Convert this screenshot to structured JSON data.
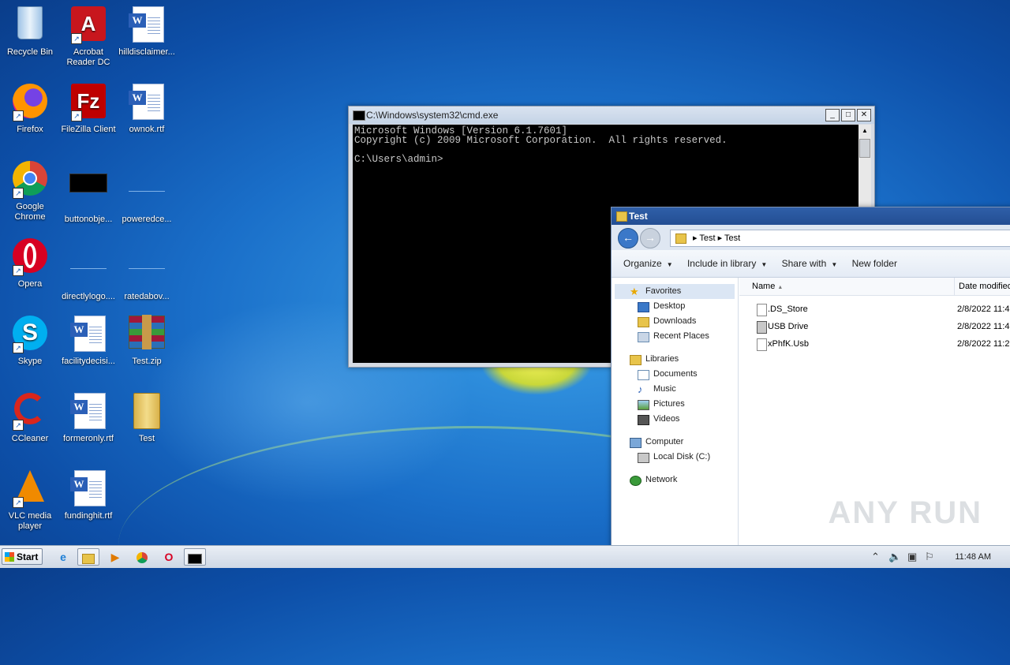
{
  "desktop": {
    "icons": [
      {
        "label": "Recycle Bin"
      },
      {
        "label": "Acrobat Reader DC"
      },
      {
        "label": "hilldisclaimer..."
      },
      {
        "label": "Firefox"
      },
      {
        "label": "FileZilla Client"
      },
      {
        "label": "ownok.rtf"
      },
      {
        "label": "Google Chrome"
      },
      {
        "label": "buttonobje..."
      },
      {
        "label": "poweredce..."
      },
      {
        "label": "Opera"
      },
      {
        "label": "directlylogo...."
      },
      {
        "label": "ratedabov..."
      },
      {
        "label": "Skype"
      },
      {
        "label": "facilitydecisi..."
      },
      {
        "label": "Test.zip"
      },
      {
        "label": "CCleaner"
      },
      {
        "label": "formeronly.rtf"
      },
      {
        "label": "Test"
      },
      {
        "label": "VLC media player"
      },
      {
        "label": "fundinghit.rtf"
      }
    ]
  },
  "cmd": {
    "title": "C:\\Windows\\system32\\cmd.exe",
    "line1": "Microsoft Windows [Version 6.1.7601]",
    "line2": "Copyright (c) 2009 Microsoft Corporation.  All rights reserved.",
    "line3": "",
    "line4": "C:\\Users\\admin>"
  },
  "explorer": {
    "title": "Test",
    "breadcrumb": "▸ Test ▸ Test",
    "toolbar": {
      "organize": "Organize",
      "include": "Include in library",
      "share": "Share with",
      "new_folder": "New folder"
    },
    "nav": {
      "favorites": "Favorites",
      "desktop": "Desktop",
      "downloads": "Downloads",
      "recent": "Recent Places",
      "libraries": "Libraries",
      "documents": "Documents",
      "music": "Music",
      "pictures": "Pictures",
      "videos": "Videos",
      "computer": "Computer",
      "local_disk": "Local Disk (C:)",
      "network": "Network"
    },
    "columns": {
      "name": "Name",
      "date": "Date modified"
    },
    "files": [
      {
        "name": ".DS_Store",
        "date": "2/8/2022 11:4"
      },
      {
        "name": "USB Drive",
        "date": "2/8/2022 11:4"
      },
      {
        "name": "xPhfK.Usb",
        "date": "2/8/2022 11:2"
      }
    ]
  },
  "watermark": "ANY RUN",
  "taskbar": {
    "start": "Start",
    "clock": "11:48 AM"
  }
}
